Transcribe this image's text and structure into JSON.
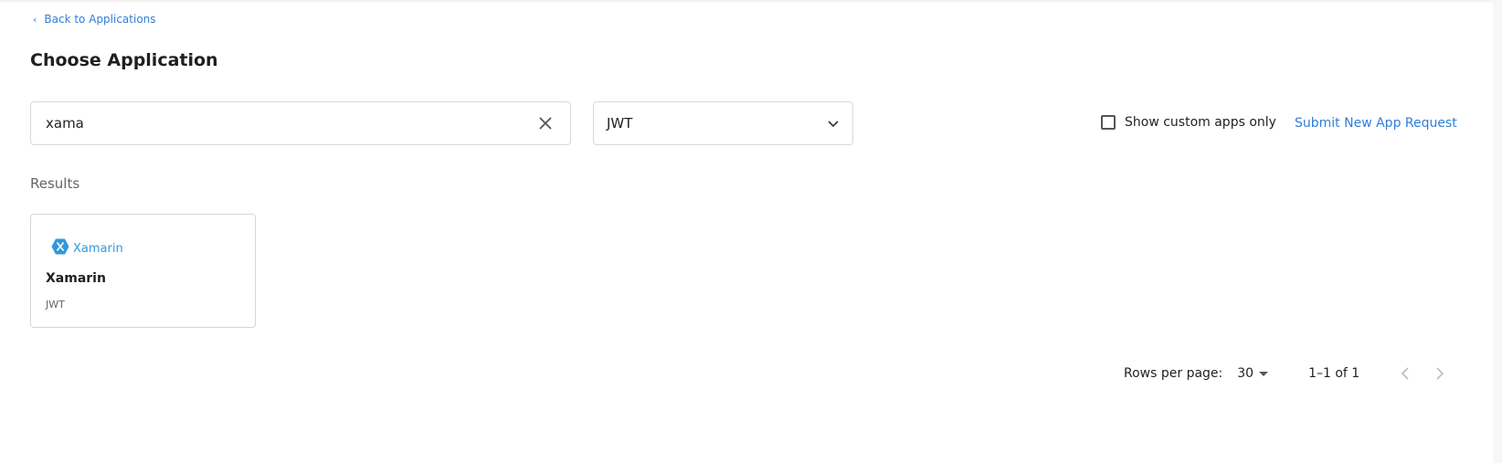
{
  "nav": {
    "back_label": "Back to Applications"
  },
  "page": {
    "title": "Choose Application"
  },
  "search": {
    "value": "xama",
    "clear_icon": "close-icon"
  },
  "filter": {
    "selected": "JWT",
    "icon": "chevron-down-icon"
  },
  "options": {
    "custom_only_label": "Show custom apps only",
    "custom_only_checked": false
  },
  "actions": {
    "submit_label": "Submit New App Request"
  },
  "results": {
    "label": "Results",
    "items": [
      {
        "logo_text": "Xamarin",
        "name": "Xamarin",
        "type": "JWT",
        "logo_icon": "xamarin-logo-icon"
      }
    ]
  },
  "pagination": {
    "rows_label": "Rows per page:",
    "rows_value": "30",
    "range": "1–1 of 1",
    "prev_icon": "chevron-left-icon",
    "next_icon": "chevron-right-icon"
  },
  "colors": {
    "link": "#2f7ed8",
    "xamarin": "#3498db",
    "border": "#d9d9d9"
  }
}
